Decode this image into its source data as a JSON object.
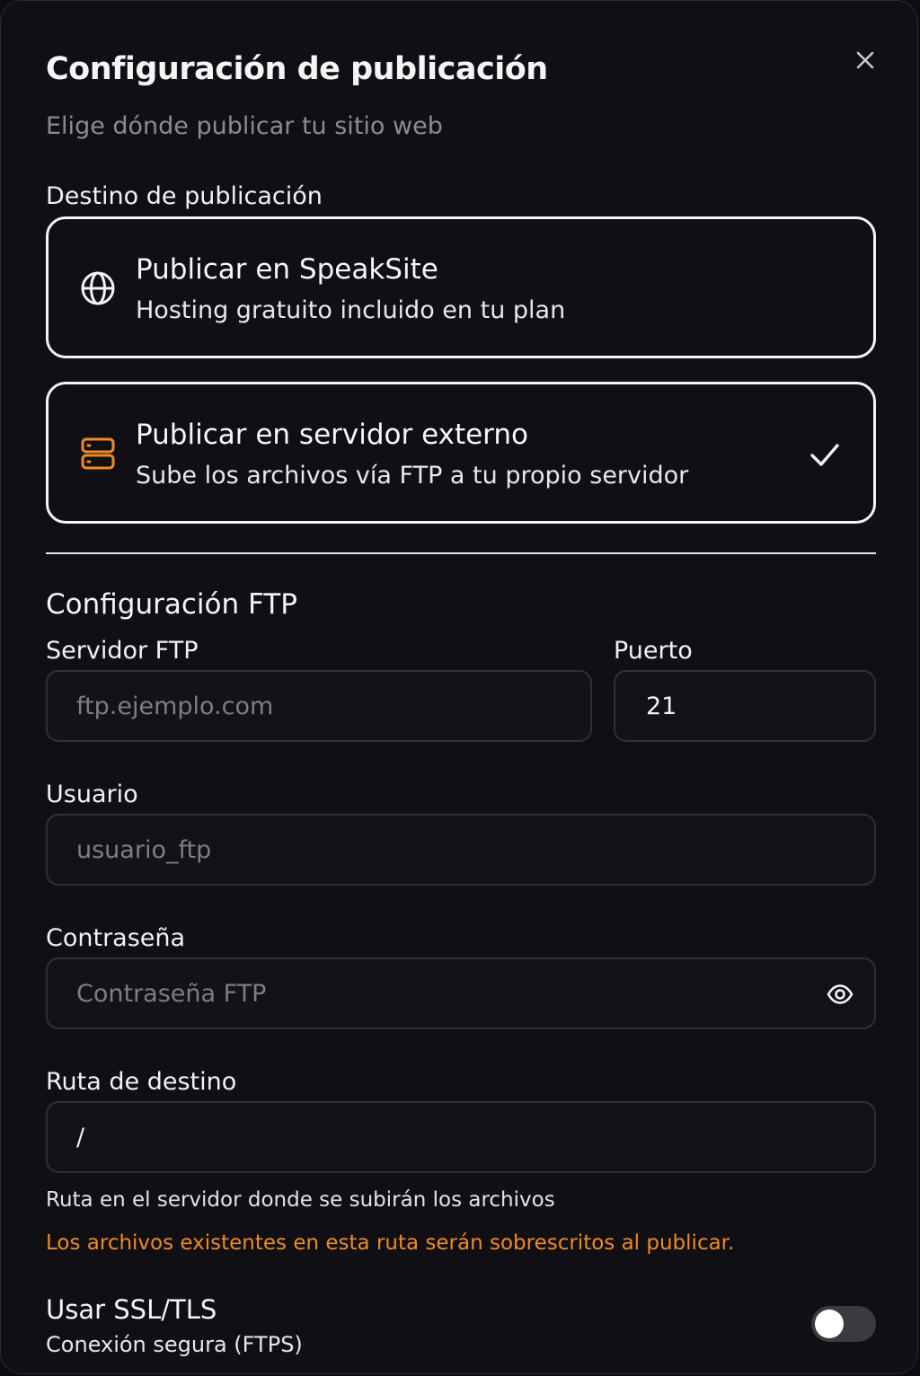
{
  "modal": {
    "title": "Configuración de publicación",
    "subtitle": "Elige dónde publicar tu sitio web"
  },
  "destination": {
    "label": "Destino de publicación",
    "options": [
      {
        "title": "Publicar en SpeakSite",
        "description": "Hosting gratuito incluido en tu plan",
        "icon": "globe-icon",
        "selected": false
      },
      {
        "title": "Publicar en servidor externo",
        "description": "Sube los archivos vía FTP a tu propio servidor",
        "icon": "server-icon",
        "selected": true
      }
    ]
  },
  "ftp": {
    "section_title": "Configuración FTP",
    "server": {
      "label": "Servidor FTP",
      "value": "",
      "placeholder": "ftp.ejemplo.com"
    },
    "port": {
      "label": "Puerto",
      "value": "21"
    },
    "user": {
      "label": "Usuario",
      "value": "",
      "placeholder": "usuario_ftp"
    },
    "password": {
      "label": "Contraseña",
      "value": "",
      "placeholder": "Contraseña FTP"
    },
    "path": {
      "label": "Ruta de destino",
      "value": "/",
      "hint": "Ruta en el servidor donde se subirán los archivos",
      "warning": "Los archivos existentes en esta ruta serán sobrescritos al publicar."
    },
    "ssl": {
      "title": "Usar SSL/TLS",
      "description": "Conexión segura (FTPS)",
      "enabled": false
    }
  },
  "colors": {
    "accent_orange": "#f08a24",
    "text_primary": "#f5f5f7",
    "text_muted": "#8b8b95",
    "input_border": "#2f2f36",
    "toggle_off": "#3a3a40"
  }
}
